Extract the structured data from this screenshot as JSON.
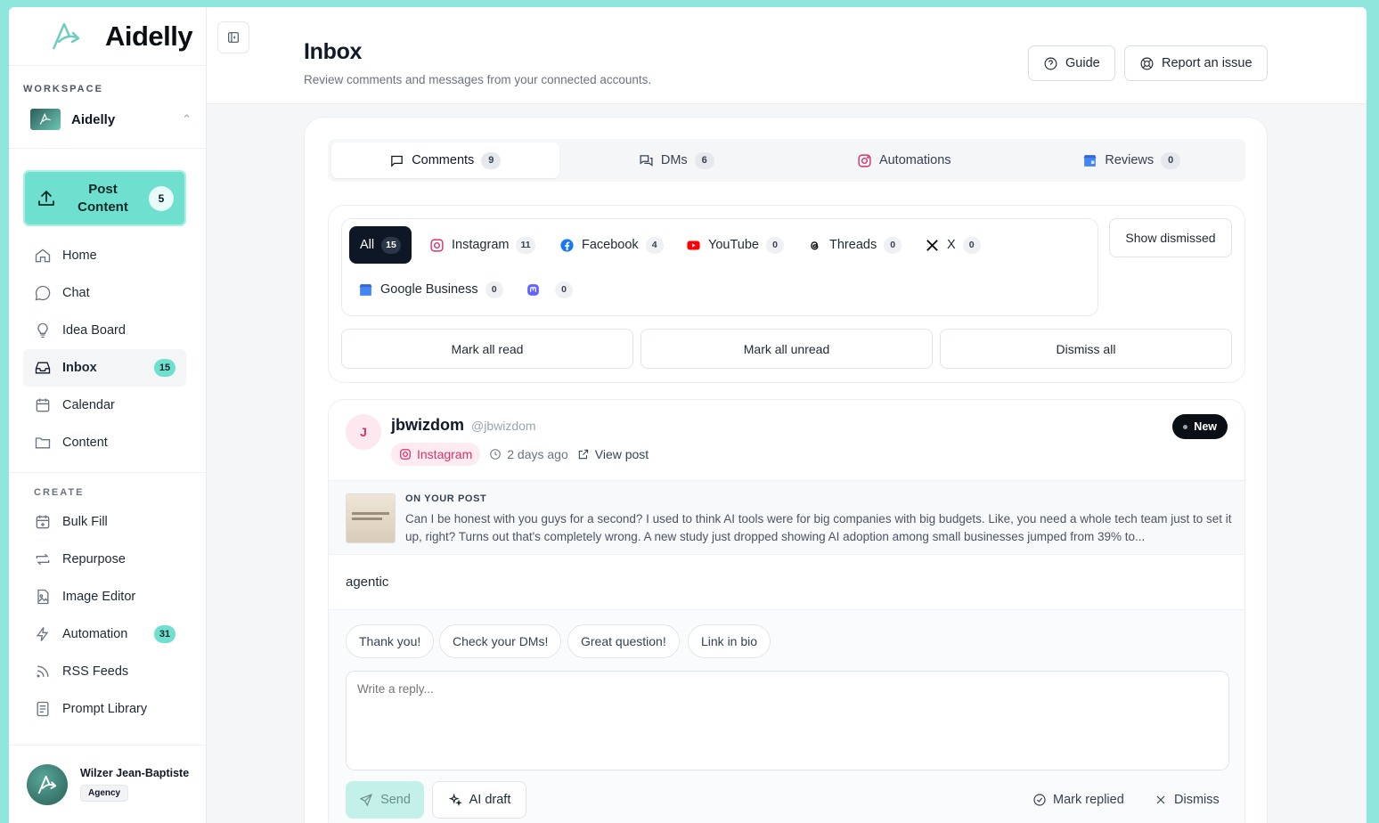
{
  "brand": {
    "name": "Aidelly"
  },
  "workspace": {
    "label": "WORKSPACE",
    "name": "Aidelly"
  },
  "post_content": {
    "label_line1": "Post",
    "label_line2": "Content",
    "count": "5"
  },
  "nav": {
    "items": [
      {
        "label": "Home",
        "icon": "home-icon"
      },
      {
        "label": "Chat",
        "icon": "chat-icon"
      },
      {
        "label": "Idea Board",
        "icon": "lightbulb-icon"
      },
      {
        "label": "Inbox",
        "icon": "inbox-icon",
        "badge": "15",
        "active": true
      },
      {
        "label": "Calendar",
        "icon": "calendar-icon"
      },
      {
        "label": "Content",
        "icon": "folder-icon"
      }
    ],
    "create_label": "CREATE",
    "create_items": [
      {
        "label": "Bulk Fill",
        "icon": "calendar-plus-icon"
      },
      {
        "label": "Repurpose",
        "icon": "repeat-icon"
      },
      {
        "label": "Image Editor",
        "icon": "image-icon"
      },
      {
        "label": "Automation",
        "icon": "bolt-icon",
        "badge": "31"
      },
      {
        "label": "RSS Feeds",
        "icon": "rss-icon"
      },
      {
        "label": "Prompt Library",
        "icon": "document-icon"
      }
    ]
  },
  "user": {
    "name": "Wilzer Jean-Baptiste",
    "plan": "Agency"
  },
  "header": {
    "title": "Inbox",
    "subtitle": "Review comments and messages from your connected accounts.",
    "guide_label": "Guide",
    "report_label": "Report an issue"
  },
  "tabs": [
    {
      "label": "Comments",
      "count": "9"
    },
    {
      "label": "DMs",
      "count": "6"
    },
    {
      "label": "Automations"
    },
    {
      "label": "Reviews",
      "count": "0"
    }
  ],
  "platforms": {
    "all": {
      "label": "All",
      "count": "15"
    },
    "instagram": {
      "label": "Instagram",
      "count": "11"
    },
    "facebook": {
      "label": "Facebook",
      "count": "4"
    },
    "youtube": {
      "label": "YouTube",
      "count": "0"
    },
    "threads": {
      "label": "Threads",
      "count": "0"
    },
    "x": {
      "label": "X",
      "count": "0"
    },
    "google": {
      "label": "Google Business",
      "count": "0"
    },
    "mastodon": {
      "count": "0"
    }
  },
  "actions": {
    "show_dismissed": "Show dismissed",
    "mark_all_read": "Mark all read",
    "mark_all_unread": "Mark all unread",
    "dismiss_all": "Dismiss all"
  },
  "comment": {
    "avatar_initial": "J",
    "author": "jbwizdom",
    "handle": "@jbwizdom",
    "badge": "New",
    "platform": "Instagram",
    "time": "2 days ago",
    "view_post": "View post",
    "ref_label": "ON YOUR POST",
    "ref_text": "Can I be honest with you guys for a second? I used to think AI tools were for big companies with big budgets. Like, you need a whole tech team just to set it up, right? Turns out that's completely wrong. A new study just dropped showing AI adoption among small businesses jumped from 39% to...",
    "text": "agentic"
  },
  "reply": {
    "quick": [
      "Thank you!",
      "Check your DMs!",
      "Great question!",
      "Link in bio"
    ],
    "placeholder": "Write a reply...",
    "send": "Send",
    "ai_draft": "AI draft",
    "mark_replied": "Mark replied",
    "dismiss": "Dismiss"
  },
  "colors": {
    "accent": "#6fe0cf",
    "instagram": "#d6336c",
    "frame": "#8fe6dc"
  }
}
